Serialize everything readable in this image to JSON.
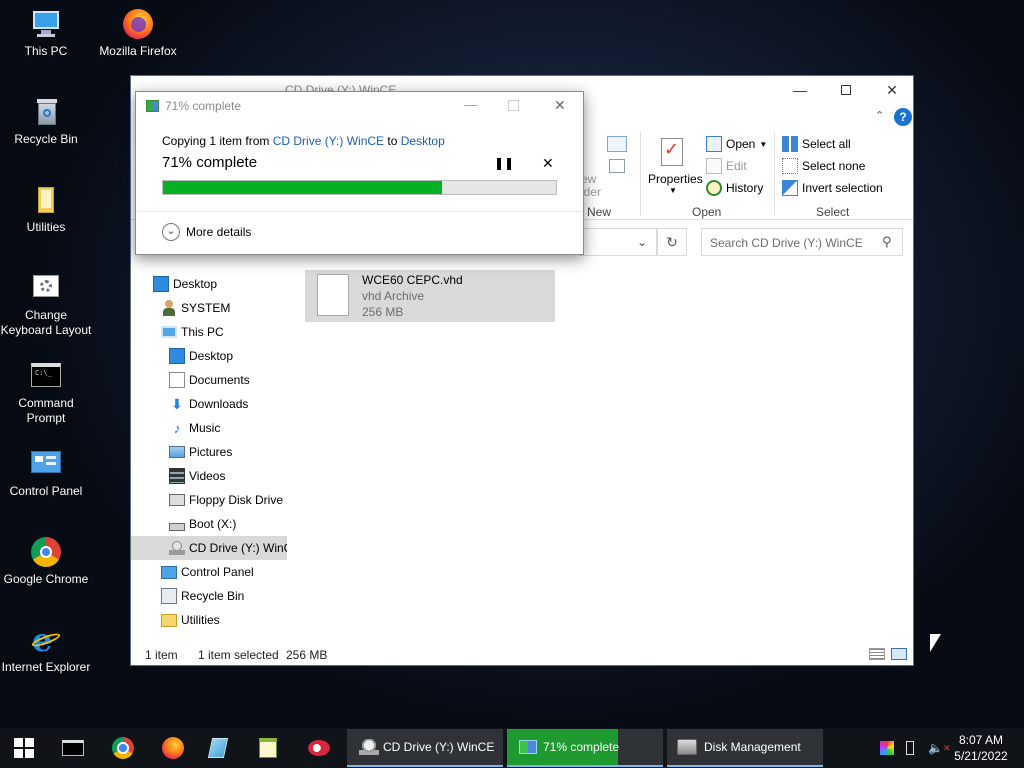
{
  "desktop": {
    "icons": [
      {
        "label": "This PC"
      },
      {
        "label": "Mozilla Firefox"
      },
      {
        "label": "Recycle Bin"
      },
      {
        "label": "Utilities"
      },
      {
        "label_line1": "Change",
        "label_line2": "Keyboard Layout"
      },
      {
        "label_line1": "Command",
        "label_line2": "Prompt"
      },
      {
        "label": "Control Panel"
      },
      {
        "label": "Google Chrome"
      },
      {
        "label": "Internet Explorer"
      }
    ]
  },
  "explorer": {
    "title": "CD Drive (Y:) WinCE",
    "ribbon": {
      "new_group_label": "New",
      "new_folder_partial": "ew",
      "new_folder_partial2": "lder",
      "properties_label": "Properties",
      "open_label": "Open",
      "edit_label": "Edit",
      "history_label": "History",
      "open_group_label": "Open",
      "select_all": "Select all",
      "select_none": "Select none",
      "invert_selection": "Invert selection",
      "select_group_label": "Select"
    },
    "search_placeholder": "Search CD Drive (Y:) WinCE",
    "nav": [
      {
        "label": "Desktop"
      },
      {
        "label": "SYSTEM"
      },
      {
        "label": "This PC"
      },
      {
        "label": "Desktop"
      },
      {
        "label": "Documents"
      },
      {
        "label": "Downloads"
      },
      {
        "label": "Music"
      },
      {
        "label": "Pictures"
      },
      {
        "label": "Videos"
      },
      {
        "label": "Floppy Disk Drive"
      },
      {
        "label": "Boot (X:)"
      },
      {
        "label": "CD Drive (Y:) WinCE"
      },
      {
        "label": "Control Panel"
      },
      {
        "label": "Recycle Bin"
      },
      {
        "label": "Utilities"
      }
    ],
    "file": {
      "name": "WCE60 CEPC.vhd",
      "type": "vhd Archive",
      "size": "256 MB"
    },
    "status": {
      "count": "1 item",
      "selected": "1 item selected",
      "size": "256 MB"
    }
  },
  "copy_dialog": {
    "title": "71% complete",
    "copying_prefix": "Copying 1 item from ",
    "source": "CD Drive (Y:) WinCE",
    "to_word": " to ",
    "destination": "Desktop",
    "percent_text": "71% complete",
    "progress_fraction": 0.71,
    "more_details": "More details",
    "accent": "#06b025"
  },
  "taskbar": {
    "tasks": [
      {
        "label": "CD Drive (Y:) WinCE"
      },
      {
        "label": "71% complete"
      },
      {
        "label": "Disk Management"
      }
    ],
    "time": "8:07 AM",
    "date": "5/21/2022"
  }
}
